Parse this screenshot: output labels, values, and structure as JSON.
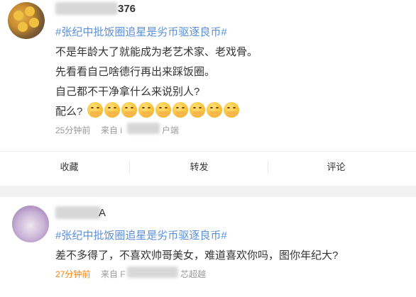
{
  "post1": {
    "username_suffix": "376",
    "topic": "#张纪中批饭圈追星是劣币驱逐良币#",
    "lines": [
      "不是年龄大了就能成为老艺术家、老戏骨。",
      "先看看自己啥德行再出来踩饭圈。",
      "自己都不干净拿什么来说别人?",
      "配么?"
    ],
    "emoji_name": "pray-face-emoji",
    "emoji_count": 9,
    "time": "25分钟前",
    "source_prefix": "来自 i",
    "source_suffix": "户端",
    "actions": {
      "collect": "收藏",
      "repost": "转发",
      "comment": "评论"
    }
  },
  "post2": {
    "username_suffix": "A",
    "topic": "#张纪中批饭圈追星是劣币驱逐良币#",
    "text": "差不多得了，不喜欢帅哥美女，难道喜欢你吗，图你年纪大?",
    "time": "27分钟前",
    "source_prefix": "来自 F",
    "source_suffix": "芯超越"
  }
}
